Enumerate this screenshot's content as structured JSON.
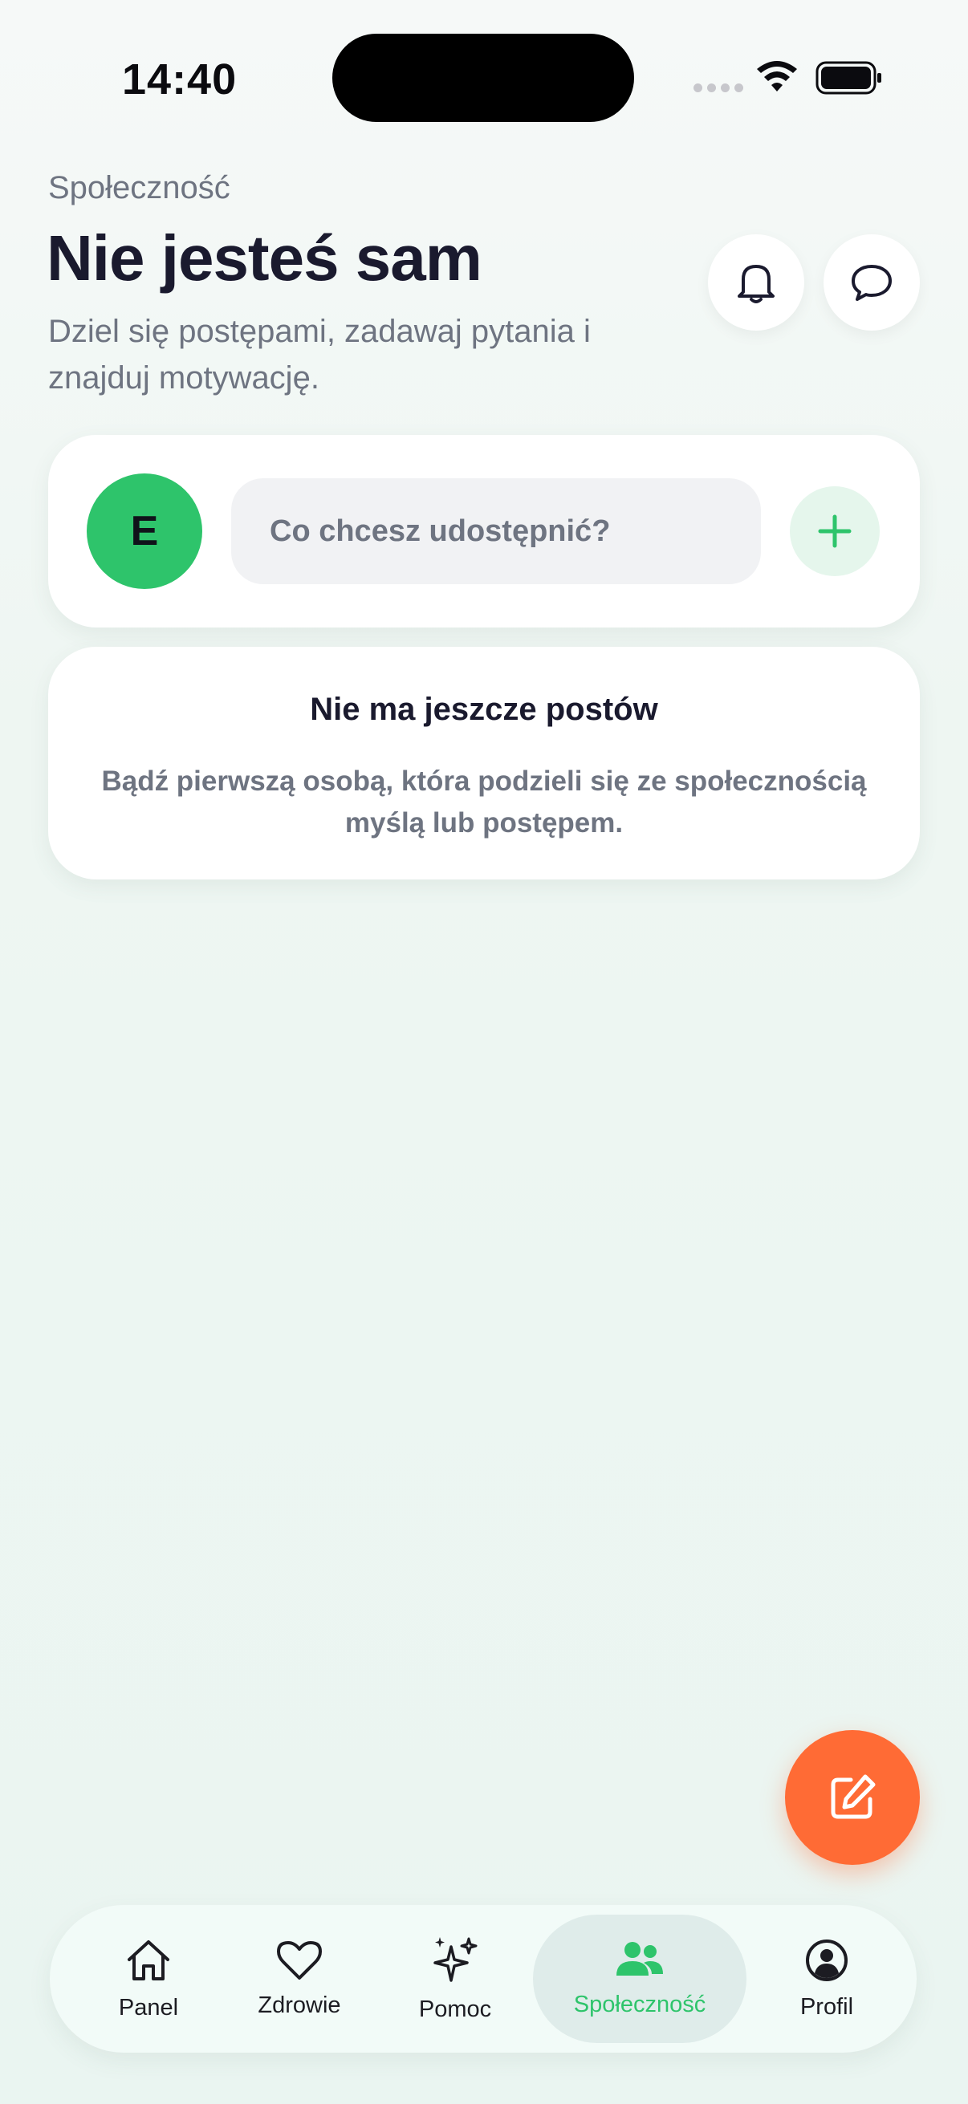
{
  "status_bar": {
    "time": "14:40"
  },
  "header": {
    "eyebrow": "Społeczność",
    "title": "Nie jesteś sam",
    "subtitle": "Dziel się postępami, zadawaj pytania i znajduj motywację."
  },
  "composer": {
    "avatar_initial": "E",
    "placeholder": "Co chcesz udostępnić?"
  },
  "empty_state": {
    "title": "Nie ma jeszcze postów",
    "body": "Bądź pierwszą osobą, która podzieli się ze społecznością myślą lub postępem."
  },
  "tabs": [
    {
      "label": "Panel",
      "icon": "home-icon",
      "active": false
    },
    {
      "label": "Zdrowie",
      "icon": "heart-icon",
      "active": false
    },
    {
      "label": "Pomoc",
      "icon": "sparkles-icon",
      "active": false
    },
    {
      "label": "Społeczność",
      "icon": "users-icon",
      "active": true
    },
    {
      "label": "Profil",
      "icon": "user-circle-icon",
      "active": false
    }
  ],
  "colors": {
    "accent_green": "#2ec46b",
    "fab_orange": "#ff6b35",
    "text_dark": "#1a1a2e",
    "text_muted": "#6e7481"
  }
}
